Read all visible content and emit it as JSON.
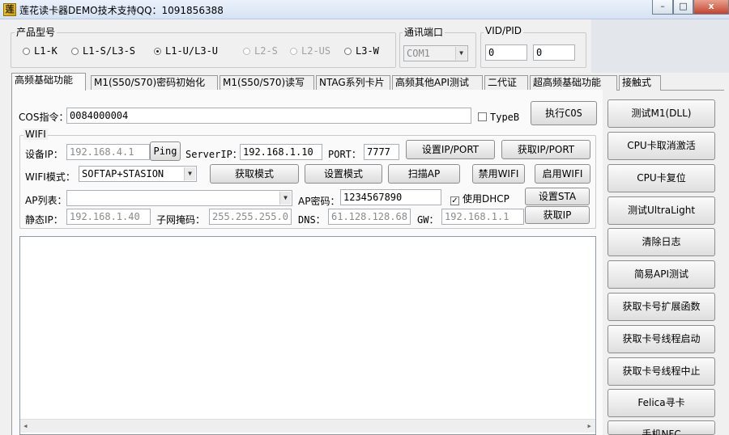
{
  "window": {
    "title": "莲花读卡器DEMO技术支持QQ：1091856388",
    "minimize": "–",
    "maximize": "□",
    "close": "x"
  },
  "product_group": {
    "label": "产品型号",
    "options": [
      {
        "label": "L1-K",
        "selected": false,
        "enabled": true
      },
      {
        "label": "L1-S/L3-S",
        "selected": false,
        "enabled": true
      },
      {
        "label": "L1-U/L3-U",
        "selected": true,
        "enabled": true
      },
      {
        "label": "L2-S",
        "selected": false,
        "enabled": false
      },
      {
        "label": "L2-US",
        "selected": false,
        "enabled": false
      },
      {
        "label": "L3-W",
        "selected": false,
        "enabled": true
      }
    ]
  },
  "port_group": {
    "label": "通讯端口",
    "value": "COM1"
  },
  "vidpid_group": {
    "label": "VID/PID",
    "vid": "0",
    "pid": "0"
  },
  "tabs": [
    {
      "label": "高频基础功能",
      "active": true
    },
    {
      "label": "M1(S50/S70)密码初始化",
      "active": false
    },
    {
      "label": "M1(S50/S70)读写",
      "active": false
    },
    {
      "label": "NTAG系列卡片",
      "active": false
    },
    {
      "label": "高频其他API测试",
      "active": false
    },
    {
      "label": "二代证",
      "active": false
    },
    {
      "label": "超高频基础功能",
      "active": false
    },
    {
      "label": "接触式",
      "active": false
    }
  ],
  "cos": {
    "label": "COS指令：",
    "value": "0084000004",
    "typeb_label": "TypeB",
    "exec_label": "执行COS"
  },
  "wifi": {
    "label": "WIFI",
    "device_ip_label": "设备IP：",
    "device_ip": "192.168.4.1",
    "ping_label": "Ping",
    "server_ip_label": "ServerIP：",
    "server_ip": "192.168.1.10",
    "port_label": "PORT：",
    "port": "7777",
    "set_ip_port": "设置IP/PORT",
    "get_ip_port": "获取IP/PORT",
    "mode_label": "WIFI模式：",
    "mode": "SOFTAP+STASION",
    "get_mode": "获取模式",
    "set_mode": "设置模式",
    "scan_ap": "扫描AP",
    "disable_wifi": "禁用WIFI",
    "enable_wifi": "启用WIFI",
    "ap_list_label": "AP列表：",
    "ap_list": "",
    "ap_pwd_label": "AP密码：",
    "ap_pwd": "1234567890",
    "dhcp_label": "使用DHCP",
    "set_sta": "设置STA",
    "static_ip_label": "静态IP：",
    "static_ip": "192.168.1.40",
    "mask_label": "子网掩码：",
    "mask": "255.255.255.0",
    "dns_label": "DNS：",
    "dns": "61.128.128.68",
    "gw_label": "GW：",
    "gw": "192.168.1.1",
    "get_ip": "获取IP"
  },
  "side_buttons": [
    "测试M1(DLL)",
    "CPU卡取消激活",
    "CPU卡复位",
    "测试UltraLight",
    "清除日志",
    "简易API测试",
    "获取卡号扩展函数",
    "获取卡号线程启动",
    "获取卡号线程中止",
    "Felica寻卡",
    "手机NFC"
  ],
  "scroll": {
    "left": "◂",
    "right": "▸"
  },
  "icons": {
    "app": "lotus-icon",
    "dropdown": "chevron-down-icon"
  }
}
